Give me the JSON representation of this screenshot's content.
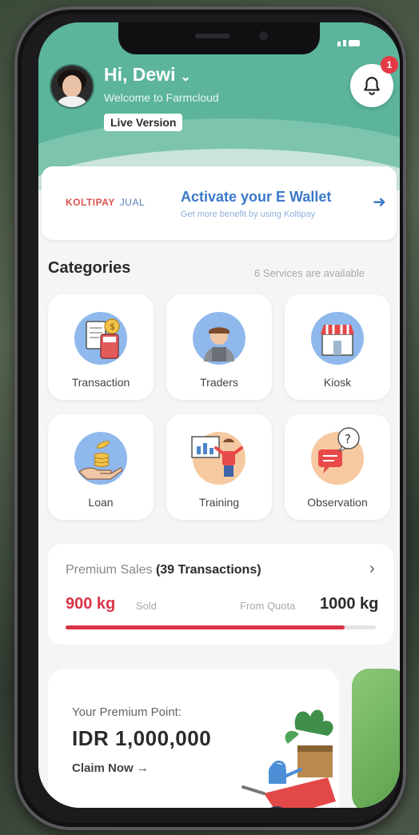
{
  "header": {
    "greeting": "Hi, Dewi",
    "welcome": "Welcome to Farmcloud",
    "version_badge": "Live Version",
    "notification_count": "1"
  },
  "wallet": {
    "logo_text": "KOLTIPAY",
    "logo_sub": "JUAL",
    "title": "Activate your E Wallet",
    "subtitle": "Get more benefit by using Koltipay"
  },
  "categories": {
    "title": "Categories",
    "available": "6 Services are available",
    "items": [
      {
        "label": "Transaction",
        "icon": "receipt-calculator-icon"
      },
      {
        "label": "Traders",
        "icon": "trader-person-icon"
      },
      {
        "label": "Kiosk",
        "icon": "kiosk-store-icon"
      },
      {
        "label": "Loan",
        "icon": "coins-hand-icon"
      },
      {
        "label": "Training",
        "icon": "training-presenter-icon"
      },
      {
        "label": "Observation",
        "icon": "observation-chat-icon"
      }
    ]
  },
  "sales": {
    "label": "Premium Sales",
    "transactions": "(39 Transactions)",
    "sold_value": "900 kg",
    "sold_label": "Sold",
    "quota_label": "From Quota",
    "quota_value": "1000 kg",
    "progress": 0.9
  },
  "points": {
    "label": "Your Premium Point:",
    "value": "IDR 1,000,000",
    "claim": "Claim Now"
  },
  "colors": {
    "header_green": "#5bb49b",
    "accent_blue": "#3b79c8",
    "accent_red": "#d93446"
  }
}
